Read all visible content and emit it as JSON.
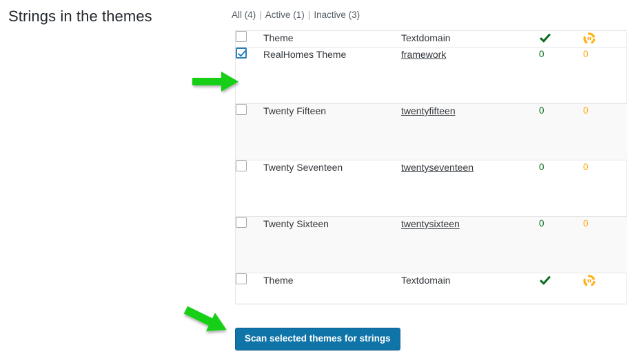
{
  "page": {
    "title": "Strings in the themes"
  },
  "filters": {
    "items": [
      {
        "label": "All (4)"
      },
      {
        "label": "Active (1)"
      },
      {
        "label": "Inactive (3)"
      }
    ],
    "separator": "|"
  },
  "table": {
    "columns": {
      "theme": "Theme",
      "textdomain": "Textdomain",
      "translated_icon": "check-icon",
      "sync_icon": "sync-icon"
    },
    "rows": [
      {
        "checked": true,
        "theme": "RealHomes Theme",
        "textdomain": "framework",
        "count_green": "0",
        "count_orange": "0",
        "striped": false
      },
      {
        "checked": false,
        "theme": "Twenty Fifteen",
        "textdomain": "twentyfifteen",
        "count_green": "0",
        "count_orange": "0",
        "striped": true
      },
      {
        "checked": false,
        "theme": "Twenty Seventeen",
        "textdomain": "twentyseventeen",
        "count_green": "0",
        "count_orange": "0",
        "striped": false
      },
      {
        "checked": false,
        "theme": "Twenty Sixteen",
        "textdomain": "twentysixteen",
        "count_green": "0",
        "count_orange": "0",
        "striped": true
      }
    ]
  },
  "actions": {
    "scan_label": "Scan selected themes for strings"
  },
  "colors": {
    "button_blue": "#0f74a8",
    "link_gray": "#32373c",
    "count_green": "#0a6b1c",
    "count_orange": "#ffa500",
    "annotation_green": "#13cf13",
    "checkbox_blue": "#2a7fbd",
    "stripe_gray": "#f9f9f9",
    "border_gray": "#e5e5e5"
  }
}
